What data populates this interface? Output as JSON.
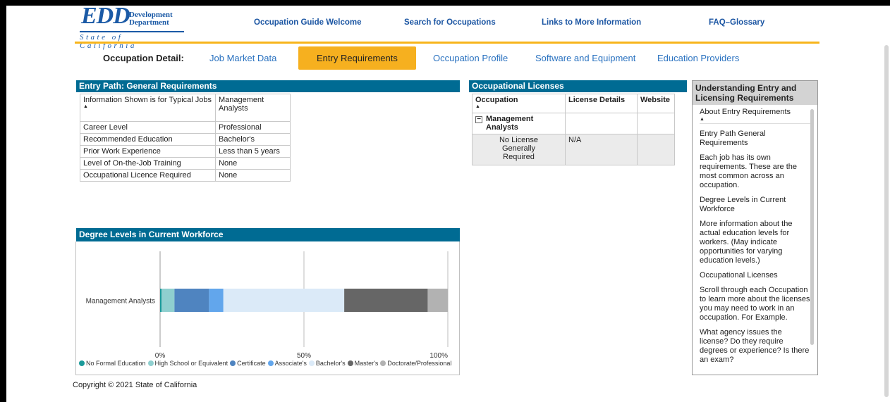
{
  "header": {
    "logo": {
      "edd": "EDD",
      "dev_line1": "Development",
      "dev_line2": "Department",
      "state": "State of California"
    },
    "nav": [
      "Occupation Guide Welcome",
      "Search for Occupations",
      "Links to More Information",
      "FAQ–Glossary"
    ]
  },
  "tabs": {
    "label": "Occupation Detail:",
    "items": [
      "Job Market Data",
      "Entry Requirements",
      "Occupation Profile",
      "Software and Equipment",
      "Education Providers"
    ],
    "active_index": 1
  },
  "entry_path": {
    "title": "Entry Path: General Requirements",
    "header": [
      "Information Shown is for Typical Jobs",
      "Management Analysts"
    ],
    "rows": [
      [
        "Career Level",
        "Professional"
      ],
      [
        "Recommended Education",
        "Bachelor's"
      ],
      [
        "Prior Work Experience",
        "Less than 5 years"
      ],
      [
        "Level of On-the-Job Training",
        "None"
      ],
      [
        "Occupational Licence Required",
        "None"
      ]
    ]
  },
  "licenses": {
    "title": "Occupational Licenses",
    "columns": [
      "Occupation",
      "License Details",
      "Website"
    ],
    "group": "Management Analysts",
    "expand_glyph": "−",
    "row": [
      "No License Generally Required",
      "N/A",
      ""
    ]
  },
  "workforce": {
    "title": "Degree Levels in Current Workforce"
  },
  "chart_data": {
    "type": "bar",
    "orientation": "horizontal",
    "stacked": true,
    "categories": [
      "Management Analysts"
    ],
    "series": [
      {
        "name": "No Formal Education",
        "values": [
          0.5
        ],
        "color": "#1a9a9a"
      },
      {
        "name": "High School or Equivalent",
        "values": [
          4.5
        ],
        "color": "#8fcfcf"
      },
      {
        "name": "Certificate",
        "values": [
          12
        ],
        "color": "#4f84c0"
      },
      {
        "name": "Associate's",
        "values": [
          5
        ],
        "color": "#62a6ec"
      },
      {
        "name": "Bachelor's",
        "values": [
          42
        ],
        "color": "#dbeaf8"
      },
      {
        "name": "Master's",
        "values": [
          29
        ],
        "color": "#666666"
      },
      {
        "name": "Doctorate/Professional",
        "values": [
          7
        ],
        "color": "#b2b2b2"
      }
    ],
    "xlim": [
      0,
      100
    ],
    "xticks": [
      "0%",
      "50%",
      "100%"
    ],
    "grid": true,
    "legend": "bottom"
  },
  "side": {
    "title": "Understanding Entry and Licensing Requirements",
    "about": "About Entry Requirements",
    "paragraphs": [
      "Entry Path General Requirements",
      "Each job has its own requirements. These are the most common across an occupation.",
      "Degree Levels in Current Workforce",
      "More information about the actual education levels for workers. (May indicate opportunities for varying education levels.)",
      "Occupational Licenses",
      "Scroll through each Occupation to learn more about the licenses you may need to work in an occupation. For Example.",
      "What agency issues the license? Do they require degrees or experience? Is there an exam?"
    ]
  },
  "footer": {
    "copyright": "Copyright © 2021 State of California"
  }
}
